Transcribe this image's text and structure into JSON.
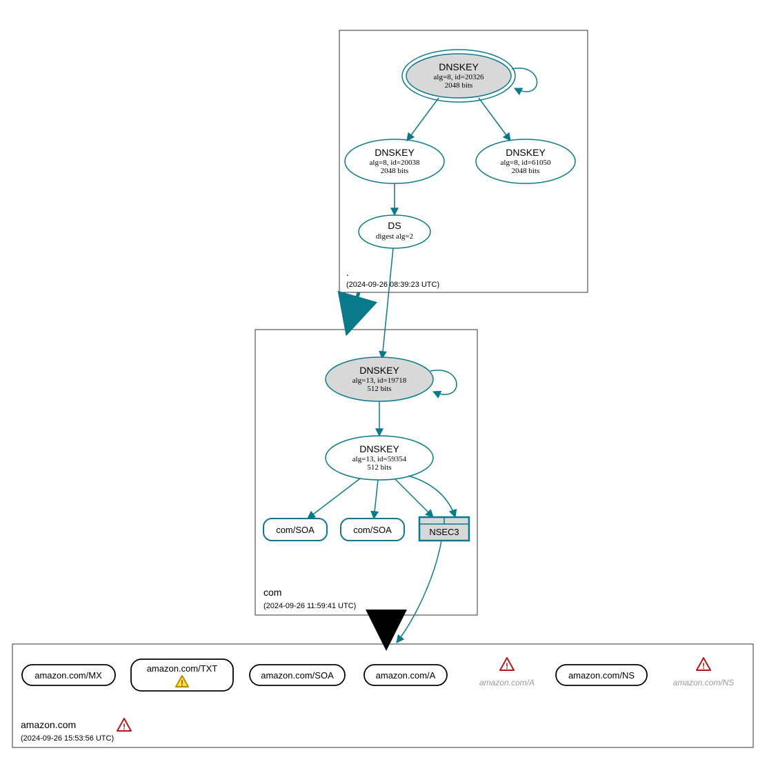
{
  "zones": {
    "root": {
      "title": ".",
      "timestamp": "(2024-09-26 08:39:23 UTC)",
      "dnskey_sep": {
        "label": "DNSKEY",
        "detail": "alg=8, id=20326",
        "bits": "2048 bits"
      },
      "dnskey_a": {
        "label": "DNSKEY",
        "detail": "alg=8, id=20038",
        "bits": "2048 bits"
      },
      "dnskey_b": {
        "label": "DNSKEY",
        "detail": "alg=8, id=61050",
        "bits": "2048 bits"
      },
      "ds": {
        "label": "DS",
        "detail": "digest alg=2"
      }
    },
    "com": {
      "title": "com",
      "timestamp": "(2024-09-26 11:59:41 UTC)",
      "dnskey_sep": {
        "label": "DNSKEY",
        "detail": "alg=13, id=19718",
        "bits": "512 bits"
      },
      "dnskey_a": {
        "label": "DNSKEY",
        "detail": "alg=13, id=59354",
        "bits": "512 bits"
      },
      "rr_soa1": "com/SOA",
      "rr_soa2": "com/SOA",
      "nsec3": "NSEC3"
    },
    "amazon": {
      "title": "amazon.com",
      "timestamp": "(2024-09-26 15:53:56 UTC)",
      "rr_mx": "amazon.com/MX",
      "rr_txt": "amazon.com/TXT",
      "rr_soa": "amazon.com/SOA",
      "rr_a": "amazon.com/A",
      "rr_a_i": "amazon.com/A",
      "rr_ns": "amazon.com/NS",
      "rr_ns_i": "amazon.com/NS"
    }
  }
}
